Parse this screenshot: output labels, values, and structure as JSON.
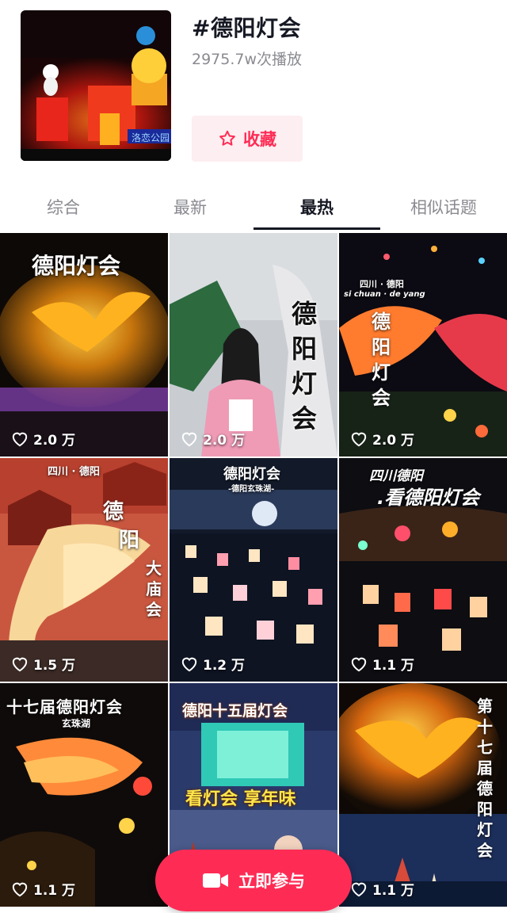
{
  "topic": {
    "title": "#德阳灯会",
    "plays": "2975.7w次播放",
    "favorite_label": "收藏",
    "cover_sign": "洛恋公园"
  },
  "tabs": [
    {
      "label": "综合",
      "active": false
    },
    {
      "label": "最新",
      "active": false
    },
    {
      "label": "最热",
      "active": true
    },
    {
      "label": "相似话题",
      "active": false
    }
  ],
  "videos": [
    {
      "likes": "2.0 万",
      "overlay": [
        "德阳灯会"
      ]
    },
    {
      "likes": "2.0 万",
      "overlay": [
        "德",
        "阳",
        "灯",
        "会"
      ]
    },
    {
      "likes": "2.0 万",
      "overlay": [
        "四川 · 德阳",
        "si chuan · de yang",
        "德",
        "阳",
        "灯",
        "会"
      ]
    },
    {
      "likes": "1.5 万",
      "overlay": [
        "四川 · 德阳",
        "德",
        "阳",
        "大",
        "庙",
        "会"
      ]
    },
    {
      "likes": "1.2 万",
      "overlay": [
        "德阳灯会",
        "-德阳玄珠湖-"
      ]
    },
    {
      "likes": "1.1 万",
      "overlay": [
        "四川德阳",
        ".看德阳灯会"
      ]
    },
    {
      "likes": "1.1 万",
      "overlay": [
        "十七届德阳灯会",
        "玄珠湖"
      ]
    },
    {
      "likes": "",
      "overlay": [
        "德阳十五届灯会",
        "看灯会 享年味"
      ]
    },
    {
      "likes": "1.1 万",
      "overlay": [
        "第",
        "十",
        "七",
        "届",
        "德",
        "阳",
        "灯",
        "会"
      ]
    }
  ],
  "join_button": {
    "label": "立即参与",
    "icon": "video-camera-icon"
  },
  "colors": {
    "accent": "#fe2c55",
    "accent_bg": "#fdeef1",
    "muted": "#8a8b91"
  }
}
